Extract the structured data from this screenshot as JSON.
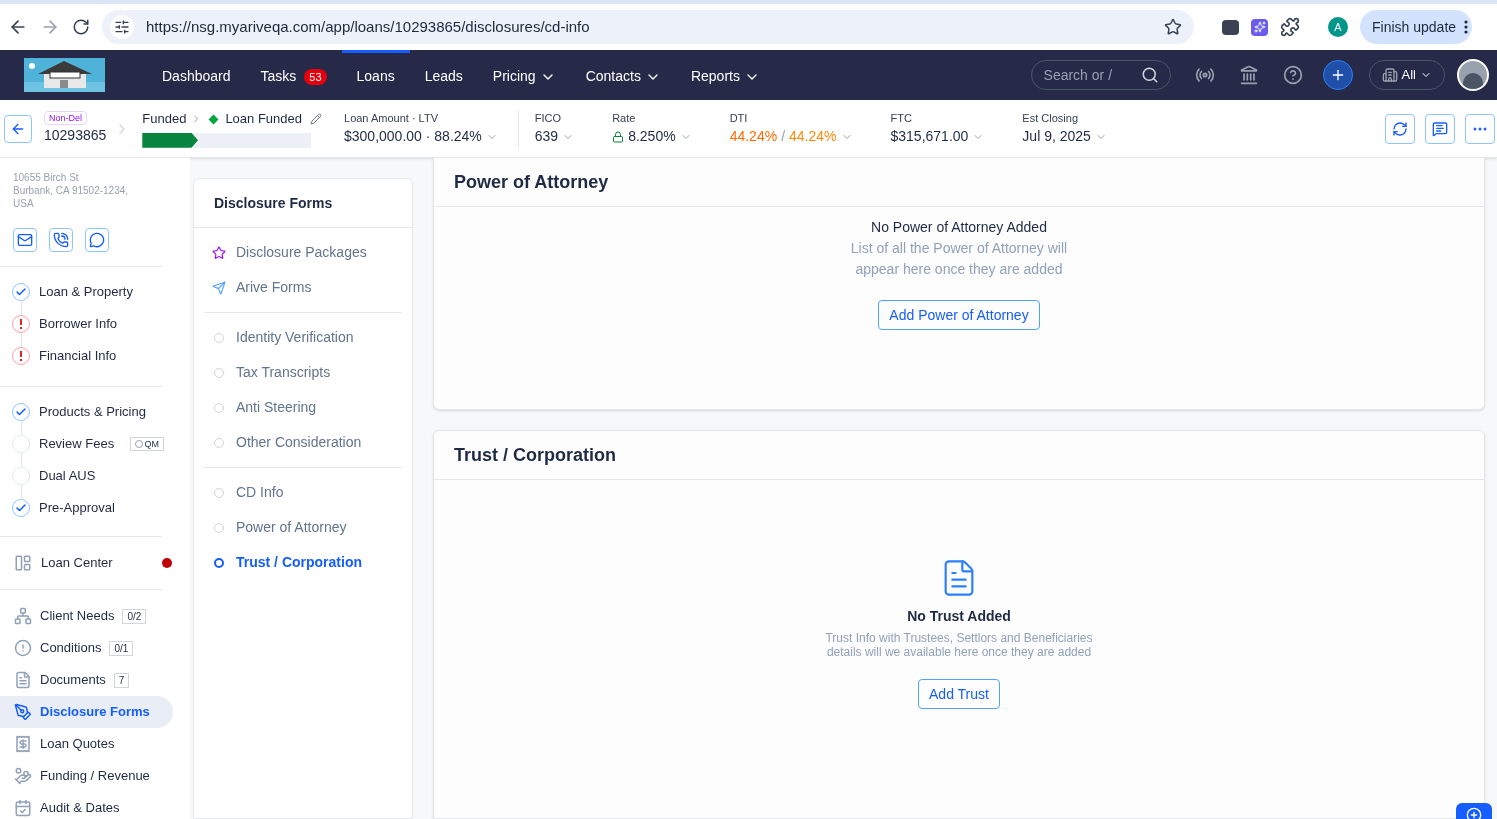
{
  "browser": {
    "url": "https://nsg.myariveqa.com/app/loans/10293865/disclosures/cd-info",
    "profile": "A",
    "update_button": "Finish update"
  },
  "nav": {
    "items": [
      {
        "label": "Dashboard",
        "selected": false
      },
      {
        "label": "Tasks",
        "badge": "53",
        "selected": false
      },
      {
        "label": "Loans",
        "selected": true
      },
      {
        "label": "Leads",
        "selected": false
      },
      {
        "label": "Pricing",
        "dropdown": true,
        "selected": false
      },
      {
        "label": "Contacts",
        "dropdown": true,
        "selected": false
      },
      {
        "label": "Reports",
        "dropdown": true,
        "selected": false
      }
    ],
    "search": {
      "placeholder": "Search or /"
    },
    "scope": "All"
  },
  "loan": {
    "tag": "Non-Del",
    "number": "10293865",
    "stage": "Funded",
    "status": "Loan Funded",
    "progress": {
      "level": 0.33
    },
    "stats": [
      {
        "label": "Loan Amount · LTV",
        "value": "$300,000.00 · 88.24%"
      },
      {
        "label": "FICO",
        "value": "639"
      },
      {
        "label": "Rate",
        "value": "8.250%",
        "locked": true
      },
      {
        "label": "DTI",
        "value": "44.24%",
        "separator": "/",
        "value2": "44.24%"
      },
      {
        "label": "FTC",
        "value": "$315,671.00"
      },
      {
        "label": "Est Closing",
        "value": "Jul 9, 2025"
      }
    ]
  },
  "sidebar": {
    "address": [
      "10655 Birch St",
      "Burbank, CA 91502-1234,",
      "USA"
    ],
    "steps": [
      [
        {
          "label": "Loan & Property",
          "kind": "done"
        },
        {
          "label": "Borrower Info",
          "kind": "error"
        },
        {
          "label": "Financial Info",
          "kind": "error"
        }
      ],
      [
        {
          "label": "Products & Pricing",
          "kind": "done"
        },
        {
          "label": "Review Fees",
          "kind": "todo",
          "tag": "QM"
        },
        {
          "label": "Dual AUS",
          "kind": "todo"
        },
        {
          "label": "Pre-Approval",
          "kind": "done"
        }
      ]
    ],
    "center": {
      "label": "Loan Center",
      "alert": true
    },
    "items": [
      {
        "label": "Client Needs",
        "count": "0/2",
        "kind": "needs",
        "selected": false
      },
      {
        "label": "Conditions",
        "count": "0/1",
        "kind": "conditions",
        "selected": false
      },
      {
        "label": "Documents",
        "count": "7",
        "kind": "documents",
        "selected": false
      },
      {
        "label": "Disclosure Forms",
        "kind": "forms",
        "selected": true
      },
      {
        "label": "Loan Quotes",
        "kind": "quotes",
        "selected": false
      },
      {
        "label": "Funding / Revenue",
        "kind": "funding",
        "selected": false
      },
      {
        "label": "Audit & Dates",
        "kind": "audit",
        "selected": false
      }
    ]
  },
  "forms_panel": {
    "title": "Disclosure Forms",
    "groups": [
      [
        {
          "label": "Disclosure Packages",
          "kind": "star",
          "selected": false
        },
        {
          "label": "Arive Forms",
          "kind": "arrow",
          "selected": false
        }
      ],
      [
        {
          "label": "Identity Verification",
          "kind": "dot",
          "selected": false
        },
        {
          "label": "Tax Transcripts",
          "kind": "dot",
          "selected": false
        },
        {
          "label": "Anti Steering",
          "kind": "dot",
          "selected": false
        },
        {
          "label": "Other Consideration",
          "kind": "dot",
          "selected": false
        }
      ],
      [
        {
          "label": "CD Info",
          "kind": "dot",
          "selected": false
        },
        {
          "label": "Power of Attorney",
          "kind": "dot",
          "selected": false
        },
        {
          "label": "Trust / Corporation",
          "kind": "dot",
          "selected": true
        }
      ]
    ]
  },
  "sections": [
    {
      "title": "Power of Attorney",
      "empty_title": "No Power of Attorney Added",
      "empty_text": [
        "List of all the Power of Attorney will",
        "appear here once they are added"
      ],
      "button": "Add Power of Attorney",
      "icon": false
    },
    {
      "title": "Trust / Corporation",
      "empty_title": "No Trust Added",
      "empty_text": [
        "Trust Info with Trustees, Settlors and Beneficiaries",
        "details will we available here once they are added"
      ],
      "button": "Add Trust",
      "icon": true
    }
  ]
}
